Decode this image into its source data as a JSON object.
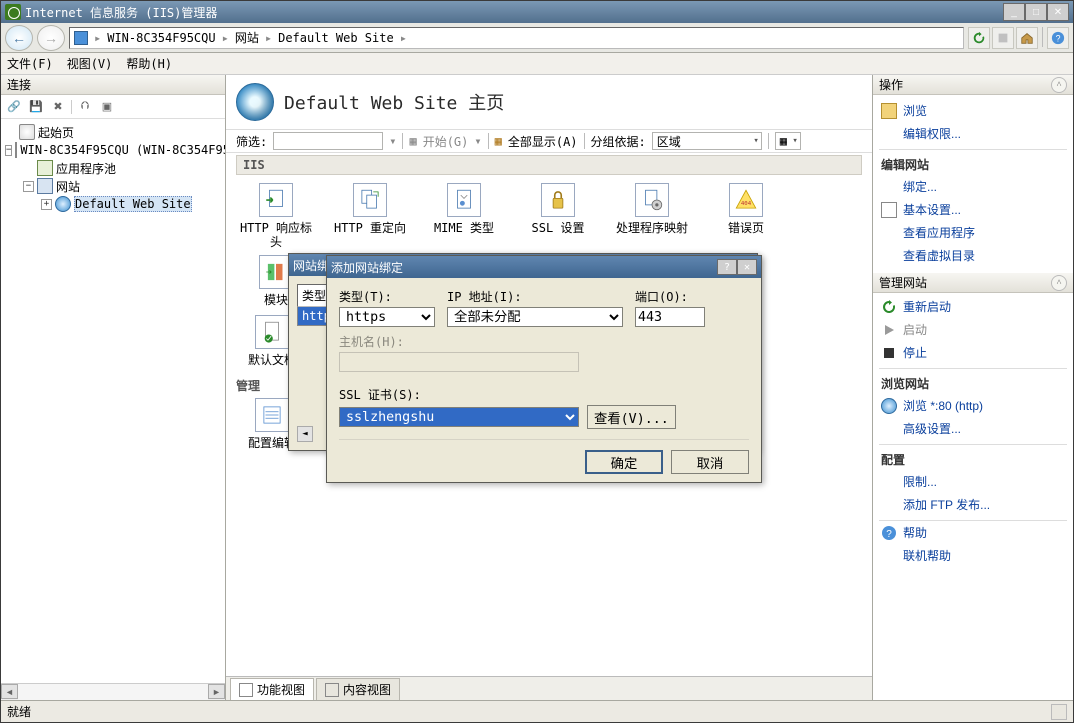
{
  "window_title": "Internet 信息服务 (IIS)管理器",
  "breadcrumb": {
    "server": "WIN-8C354F95CQU",
    "sites": "网站",
    "site": "Default Web Site"
  },
  "menus": {
    "file": "文件(F)",
    "view": "视图(V)",
    "help": "帮助(H)"
  },
  "left": {
    "header": "连接",
    "nodes": {
      "start": "起始页",
      "server": "WIN-8C354F95CQU (WIN-8C354F95",
      "apppools": "应用程序池",
      "sites": "网站",
      "defaultsite": "Default Web Site"
    }
  },
  "center": {
    "title": "Default Web Site 主页",
    "filter_label": "筛选:",
    "filter_value": "",
    "start_btn": "开始(G)",
    "showall": "全部显示(A)",
    "groupby_label": "分组依据:",
    "groupby_value": "区域",
    "category": "IIS",
    "features": {
      "resp_hdr": "HTTP 响应标头",
      "redirect": "HTTP 重定向",
      "mime": "MIME 类型",
      "ssl": "SSL 设置",
      "handler": "处理程序映射",
      "errorpages": "错误页",
      "modules": "模块",
      "defdoc": "默认文档"
    },
    "manage_label": "管理",
    "cfgedit": "配置编辑",
    "view_feat": "功能视图",
    "view_cont": "内容视图"
  },
  "right": {
    "header": "操作",
    "browse": "浏览",
    "editperm": "编辑权限...",
    "g_editsite": "编辑网站",
    "bindings": "绑定...",
    "basic": "基本设置...",
    "viewapps": "查看应用程序",
    "viewvdirs": "查看虚拟目录",
    "g_manage": "管理网站",
    "restart": "重新启动",
    "start": "启动",
    "stop": "停止",
    "g_browse": "浏览网站",
    "browse80": "浏览 *:80 (http)",
    "adv": "高级设置...",
    "g_config": "配置",
    "limits": "限制...",
    "addftp": "添加 FTP 发布...",
    "help": "帮助",
    "onlinehelp": "联机帮助"
  },
  "dlg_back": {
    "title": "网站绑",
    "col_type": "类型",
    "row_type": "http"
  },
  "dlg_front": {
    "title": "添加网站绑定",
    "lbl_type": "类型(T):",
    "val_type": "https",
    "lbl_ip": "IP 地址(I):",
    "val_ip": "全部未分配",
    "lbl_port": "端口(O):",
    "val_port": "443",
    "lbl_host": "主机名(H):",
    "val_host": "",
    "lbl_ssl": "SSL 证书(S):",
    "val_ssl": "sslzhengshu",
    "btn_view": "查看(V)...",
    "btn_ok": "确定",
    "btn_cancel": "取消"
  },
  "status": "就绪"
}
